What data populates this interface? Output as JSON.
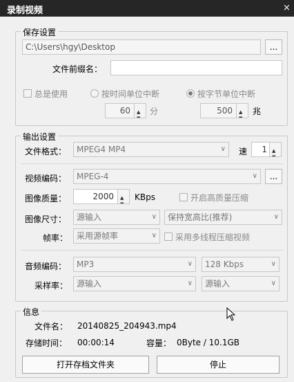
{
  "window": {
    "title": "录制视频",
    "close_glyph": "×"
  },
  "save": {
    "group_label": "保存设置",
    "path": "C:\\Users\\hgy\\Desktop",
    "browse_label": "...",
    "prefix_label": "文件前缀名：",
    "prefix_value": "",
    "always_use_label": "总是使用",
    "split_time_label": "按时间单位中断",
    "split_size_label": "按字节单位中断",
    "time_value": "60",
    "time_unit": "分",
    "size_value": "500",
    "size_unit": "兆"
  },
  "output": {
    "group_label": "输出设置",
    "format_label": "文件格式：",
    "format_value": "MPEG4 MP4",
    "speed_label": "速",
    "speed_value": "1",
    "vcodec_label": "视频编码：",
    "vcodec_value": "MPEG-4",
    "vcodec_btn": "...",
    "quality_label": "图像质量：",
    "quality_value": "2000",
    "quality_unit": "KBps",
    "hq_label": "开启高质量压缩",
    "size_label": "图像尺寸：",
    "size_value": "源输入",
    "aspect_value": "保持宽高比(推荐)",
    "fps_label": "帧率：",
    "fps_value": "采用源帧率",
    "mt_label": "采用多线程压缩视频",
    "acodec_label": "音频编码：",
    "acodec_value": "MP3",
    "abitrate_value": "128 Kbps",
    "srate_label": "采样率：",
    "srate_value": "源输入",
    "channel_value": "源输入"
  },
  "info": {
    "group_label": "信息",
    "filename_label": "文件名：",
    "filename_value": "20140825_204943.mp4",
    "time_label": "存储时间：",
    "time_value": "00:00:14",
    "capacity_label": "容量：",
    "capacity_value": "0Byte / 10.1GB"
  },
  "actions": {
    "open_folder": "打开存档文件夹",
    "stop": "停止"
  },
  "icons": {
    "dropdown": "chevron-down-icon",
    "spin_up": "▲",
    "spin_down": "▼",
    "arrow": "∨"
  }
}
